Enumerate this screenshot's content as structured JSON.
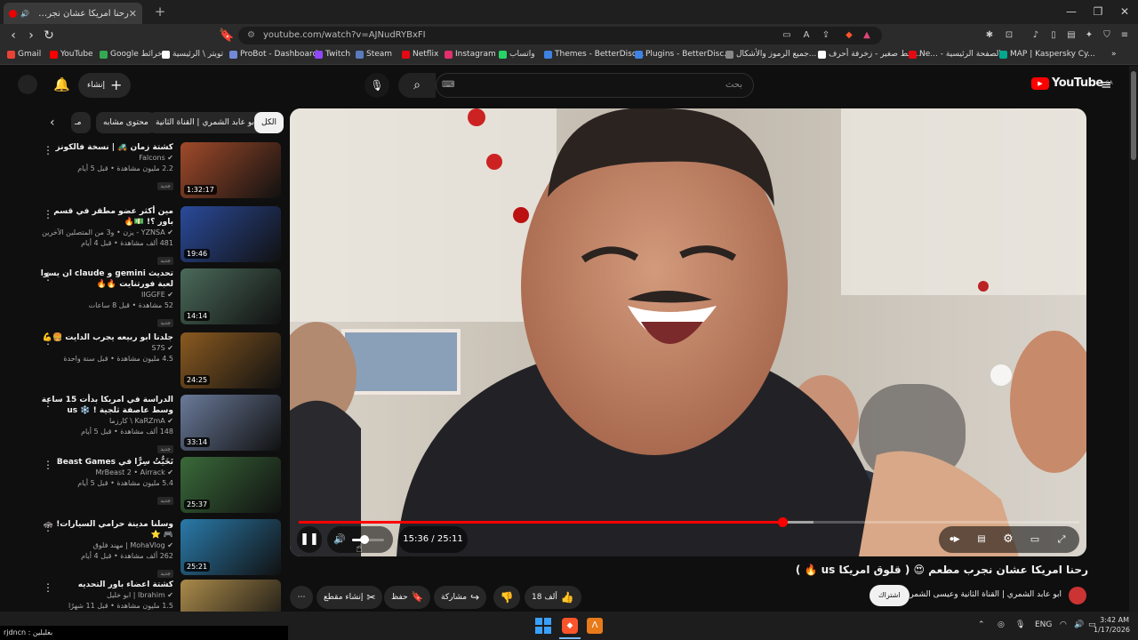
{
  "browser": {
    "tab_title": "رحنا امريكا عشان نجرب مطعم 😍 ( قلوق امريكا us 🔥 )",
    "url": "youtube.com/watch?v=AJNudRYBxFI",
    "bookmarks": [
      {
        "label": "Gmail",
        "color": "#ea4335"
      },
      {
        "label": "YouTube",
        "color": "#ff0000"
      },
      {
        "label": "Google خرائط",
        "color": "#34a853"
      },
      {
        "label": "تويتر \\ الرئيسية",
        "color": "#ffffff"
      },
      {
        "label": "ProBot - Dashboard",
        "color": "#7289da"
      },
      {
        "label": "Twitch",
        "color": "#9146ff"
      },
      {
        "label": "Steam",
        "color": "#1b2838"
      },
      {
        "label": "Netflix",
        "color": "#e50914"
      },
      {
        "label": "Instagram",
        "color": "#e1306c"
      },
      {
        "label": "واتساب",
        "color": "#25d366"
      },
      {
        "label": "Themes - BetterDisc...",
        "color": "#3e82e5"
      },
      {
        "label": "Plugins - BetterDisc...",
        "color": "#3e82e5"
      },
      {
        "label": "جميع الرموز والأشكال...",
        "color": "#888888"
      },
      {
        "label": "خط صغير - زخرفة أحرف...",
        "color": "#ffffff"
      },
      {
        "label": "Ne... - الصفحة الرئيسية",
        "color": "#e50914"
      },
      {
        "label": "MAP | Kaspersky Cy...",
        "color": "#00a88e"
      }
    ]
  },
  "youtube": {
    "create_label": "إنشاء",
    "search_placeholder": "بحث",
    "logo_text": "YouTube",
    "logo_region": "SA",
    "chips": [
      {
        "label": "الكل",
        "active": true
      },
      {
        "label": "من ابو عابد الشمري | القناة الثانية",
        "active": false
      },
      {
        "label": "محتوى مشابه",
        "active": false
      },
      {
        "label": "مـ",
        "active": false
      }
    ],
    "recommendations": [
      {
        "title": "كشتة زمان 🚜 | نسخة فالكونز",
        "channel": "Falcons",
        "stats": "2.2 مليون مشاهدة • قبل 5 أيام",
        "badge": "جديد",
        "duration": "1:32:17",
        "thumb": "#a04a2a"
      },
      {
        "title": "مين أكثر عضو مطقر في قسم باور ؟! 💵🔥",
        "channel": "YZNSA - يزن • و3 من المتصلين الآخرين",
        "stats": "481 ألف مشاهدة • قبل 4 أيام",
        "badge": "جديد",
        "duration": "19:46",
        "thumb": "#2a4a9a"
      },
      {
        "title": "تحديث gemini و claude ان يسوا لعبة فورتنايت 🔥🔥",
        "channel": "IIGGFE",
        "stats": "52 مشاهدة • قبل 8 ساعات",
        "badge": "جديد",
        "duration": "14:14",
        "thumb": "#4a6a5a"
      },
      {
        "title": "جلدنا ابو ربيعه يجرب الدايت 🍔💪",
        "channel": "S7S",
        "stats": "4.5 مليون مشاهدة • قبل سنة واحدة",
        "badge": "",
        "duration": "24:25",
        "thumb": "#8a5a20"
      },
      {
        "title": "الدراسة في امريكا بدأت 15 ساعة وسط عاصفة ثلجية ! ❄️ us",
        "channel": "KaRZmA \\ كارزما",
        "stats": "148 ألف مشاهدة • قبل 5 أيام",
        "badge": "جديد",
        "duration": "33:14",
        "thumb": "#6a7a9a"
      },
      {
        "title": "تَخَيُّتُ سِرًّا في Beast Games",
        "channel": "MrBeast 2 • Airrack",
        "stats": "5.4 مليون مشاهدة • قبل 5 أيام",
        "badge": "جديد",
        "duration": "25:37",
        "thumb": "#3a6a3a"
      },
      {
        "title": "وسلنا مدينة حرامي السيارات! 🚓 🎮 ⭐",
        "channel": "MohaVlog | مهند فلوق",
        "stats": "262 ألف مشاهدة • قبل 4 أيام",
        "badge": "جديد",
        "duration": "25:21",
        "thumb": "#2a7aaa"
      },
      {
        "title": "كشتة اعضاء باور التحديه",
        "channel": "Ibrahim | ابو خليل",
        "stats": "1.5 مليون مشاهدة • قبل 11 شهرًا",
        "badge": "",
        "duration": "",
        "thumb": "#aa8a4a"
      }
    ],
    "player": {
      "current_time": "15:36",
      "total_time": "25:11",
      "progress_fraction": 0.62,
      "buffered_fraction": 0.66,
      "volume_fraction": 0.4
    },
    "video": {
      "title": "رحنا امريكا عشان نجرب مطعم 😍 ( قلوق امريكا us 🔥 )",
      "channel": "ابو عابد الشمري | القناة الثانية وعيسى الشمري",
      "subscribe_label": "اشتراك",
      "likes": "18 ألف",
      "share_label": "مشاركة",
      "save_label": "حفظ",
      "clip_label": "إنشاء مقطع"
    }
  },
  "taskbar": {
    "status_text": "rjdncn : بغلبلين",
    "lang": "ENG",
    "time": "3:42 AM",
    "date": "1/17/2026"
  }
}
